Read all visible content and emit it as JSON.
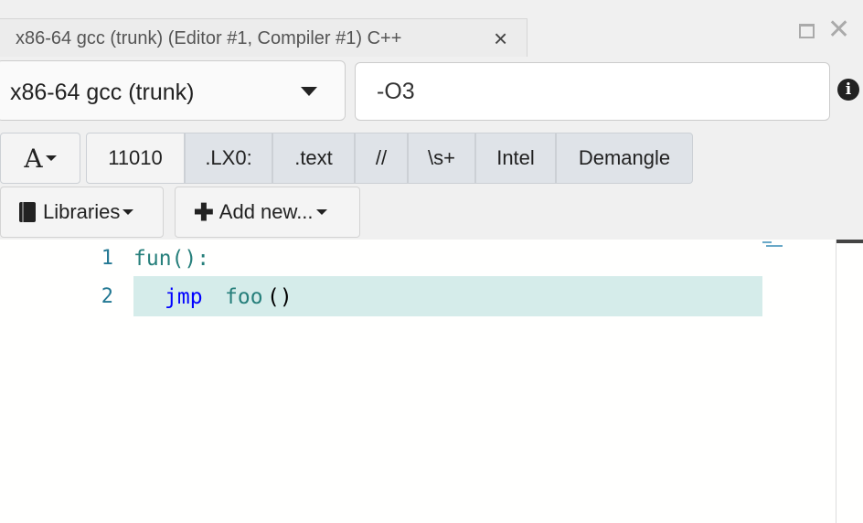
{
  "tab": {
    "title": "x86-64 gcc (trunk) (Editor #1, Compiler #1) C++",
    "close_glyph": "×"
  },
  "window": {
    "close_glyph": "✕"
  },
  "compiler": {
    "selected": "x86-64 gcc (trunk)",
    "options_value": "-O3"
  },
  "filters": {
    "font_label": "A",
    "buttons": [
      "11010",
      ".LX0:",
      ".text",
      "//",
      "\\s+",
      "Intel",
      "Demangle"
    ]
  },
  "libraries": {
    "libraries_label": "Libraries",
    "add_new_label": "Add new...",
    "add_glyph": "✚"
  },
  "info_glyph": "i",
  "editor": {
    "lines": [
      {
        "number": "1",
        "label": "fun():",
        "instr": "",
        "operand": "",
        "paren": ""
      },
      {
        "number": "2",
        "label": "",
        "instr": "jmp",
        "operand": "foo",
        "paren": "()"
      }
    ]
  },
  "colors": {
    "highlight": "#d5ecea",
    "line_number": "#237893",
    "label": "#267f7b",
    "keyword": "#0000ff"
  }
}
